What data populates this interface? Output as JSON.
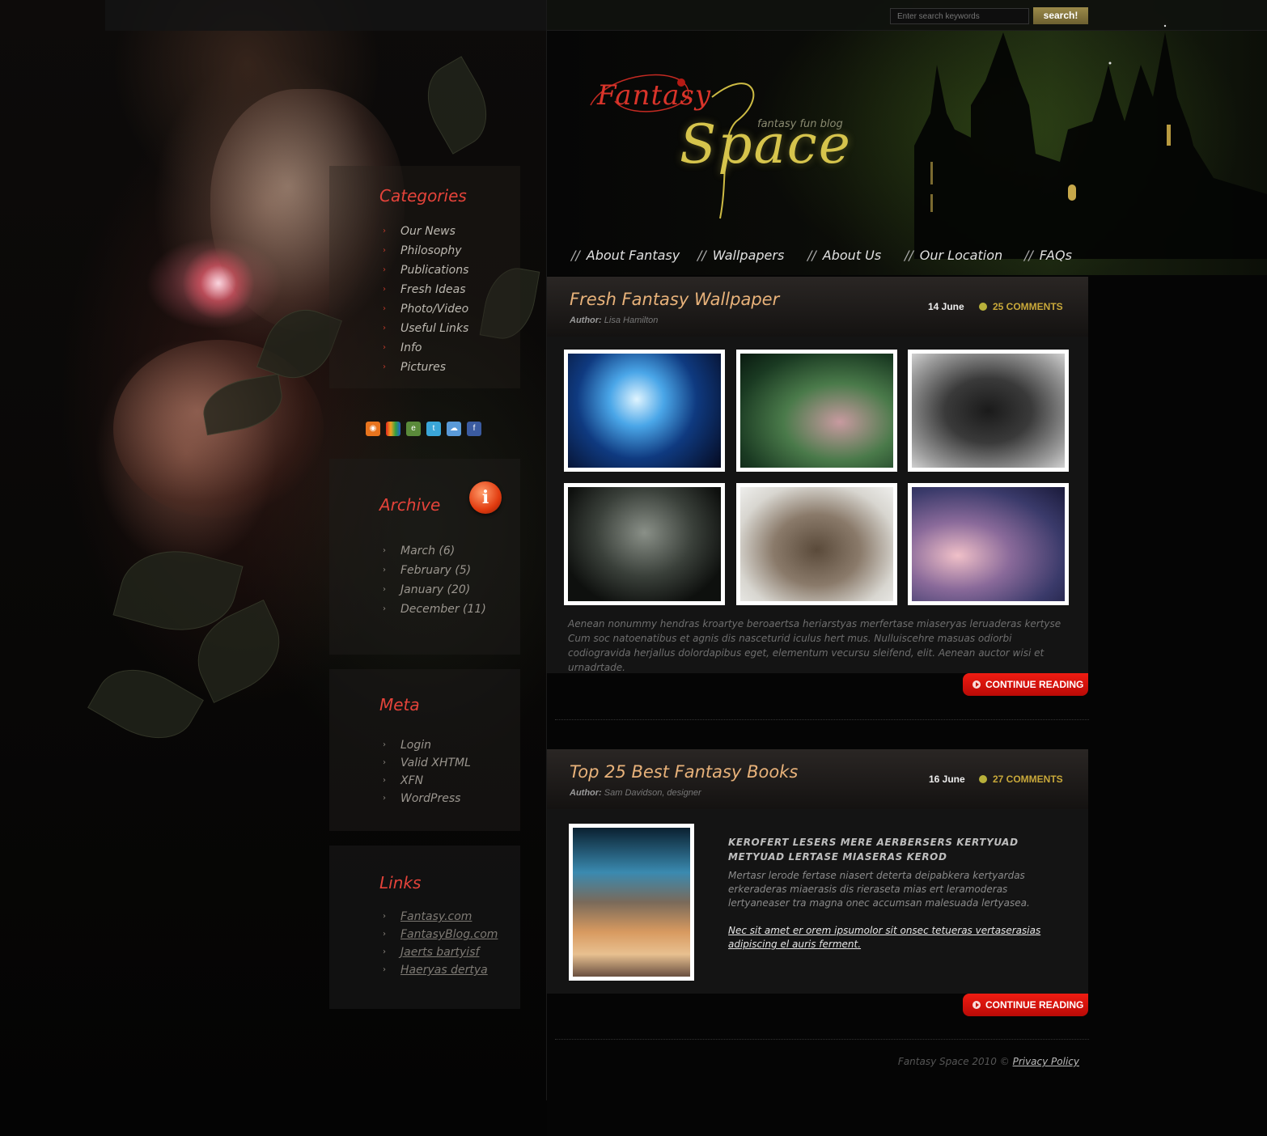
{
  "search": {
    "placeholder": "Enter search keywords",
    "button_label": "search!"
  },
  "logo": {
    "word1": "Fantasy",
    "word2": "Space",
    "tagline": "fantasy fun blog"
  },
  "nav": [
    {
      "label": "About Fantasy"
    },
    {
      "label": "Wallpapers"
    },
    {
      "label": "About Us"
    },
    {
      "label": "Our Location"
    },
    {
      "label": "FAQs"
    }
  ],
  "nav_separator": "//",
  "sidebar": {
    "categories": {
      "title": "Categories",
      "items": [
        "Our News",
        "Philosophy",
        "Publications",
        "Fresh Ideas",
        "Photo/Video",
        "Useful Links",
        "Info",
        "Pictures"
      ]
    },
    "social_icons": [
      "rss-icon",
      "flickr-icon",
      "evernote-icon",
      "twitter-icon",
      "cloud-icon",
      "facebook-icon"
    ],
    "archive": {
      "title": "Archive",
      "badge": "i",
      "items": [
        "March (6)",
        "February (5)",
        "January (20)",
        "December (11)"
      ]
    },
    "meta": {
      "title": "Meta",
      "items": [
        "Login",
        "Valid XHTML",
        "XFN",
        "WordPress"
      ]
    },
    "links": {
      "title": "Links",
      "items": [
        "Fantasy.com",
        "FantasyBlog.com",
        "Jaerts bartyisf",
        "Haeryas dertya"
      ]
    }
  },
  "posts": [
    {
      "title": "Fresh Fantasy Wallpaper",
      "author_label": "Author:",
      "author": "Lisa Hamilton",
      "date": "14 June",
      "comments": "25 COMMENTS",
      "text": "Aenean nonummy hendras kroartye beroaertsa heriarstyas merfertase miaseryas leruaderas kertyse Cum soc natoenatibus et agnis dis nasceturid iculus hert mus. Nulluiscehre masuas odiorbi codiogravida herjallus dolordapibus eget, elementum vecursu sleifend, elit. Aenean auctor wisi et urnadrtade.",
      "continue_label": "CONTINUE READING"
    },
    {
      "title": "Top 25 Best Fantasy Books",
      "author_label": "Author:",
      "author": "Sam Davidson, designer",
      "date": "16 June",
      "comments": "27 COMMENTS",
      "heading": "KEROFERT LESERS MERE AERBERSERS KERTYUAD METYUAD LERTASE MIASERAS KEROD",
      "paragraph": "Mertasr lerode fertase niasert deterta deipabkera kertyardas erkeraderas miaerasis dis rieraseta mias ert leramoderas lertyaneaser tra magna onec accumsan malesuada lertyasea.",
      "link": "Nec sit amet er orem ipsumolor sit onsec tetueras vertaserasias adipiscing el auris ferment.",
      "continue_label": "CONTINUE READING"
    }
  ],
  "footer": {
    "text": "Fantasy Space 2010 ©",
    "link": "Privacy Policy"
  }
}
